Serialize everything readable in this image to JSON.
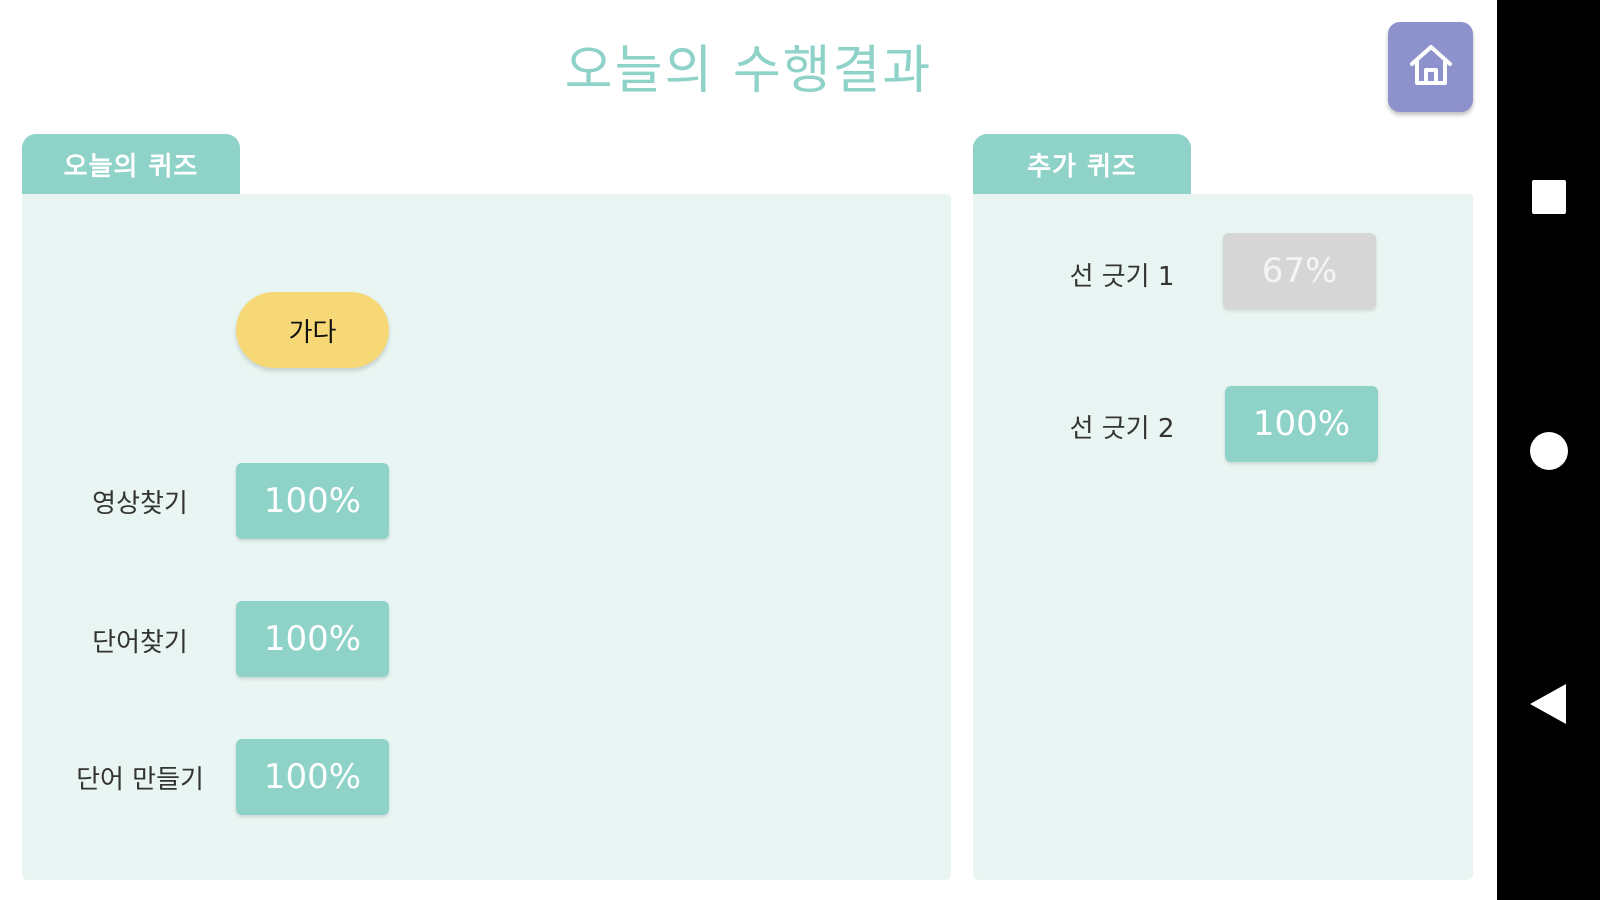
{
  "header": {
    "title": "오늘의 수행결과",
    "home_icon": "home-icon"
  },
  "today_quiz": {
    "tab_label": "오늘의 퀴즈",
    "go_button_label": "가다",
    "rows": [
      {
        "label": "영상찾기",
        "value": "100%"
      },
      {
        "label": "단어찾기",
        "value": "100%"
      },
      {
        "label": "단어 만들기",
        "value": "100%"
      }
    ]
  },
  "extra_quiz": {
    "tab_label": "추가 퀴즈",
    "rows": [
      {
        "label": "선 긋기 1",
        "value": "67%",
        "status": "incomplete"
      },
      {
        "label": "선 긋기 2",
        "value": "100%",
        "status": "complete"
      }
    ]
  },
  "colors": {
    "accent": "#8ed2c8",
    "panel_bg": "#e8f5f2",
    "home_button": "#8e92cc",
    "go_button": "#f7d877",
    "incomplete": "#d6d6d6"
  },
  "nav": {
    "recents_icon": "square-icon",
    "home_icon": "circle-icon",
    "back_icon": "back-triangle-icon"
  }
}
